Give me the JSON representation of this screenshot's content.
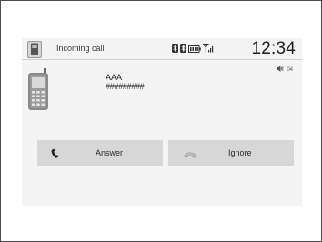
{
  "header": {
    "title": "Incoming call",
    "time": "12:34",
    "status_icons": [
      "bluetooth-icon",
      "bluetooth-icon",
      "battery-icon",
      "signal-icon"
    ]
  },
  "volume": {
    "icon": "speaker-icon",
    "level": "04"
  },
  "caller": {
    "icon": "cell-phone-icon",
    "name": "AAA",
    "number": "#########"
  },
  "actions": {
    "answer_label": "Answer",
    "answer_icon": "handset-icon",
    "ignore_label": "Ignore",
    "ignore_icon": "hang-up-icon"
  }
}
